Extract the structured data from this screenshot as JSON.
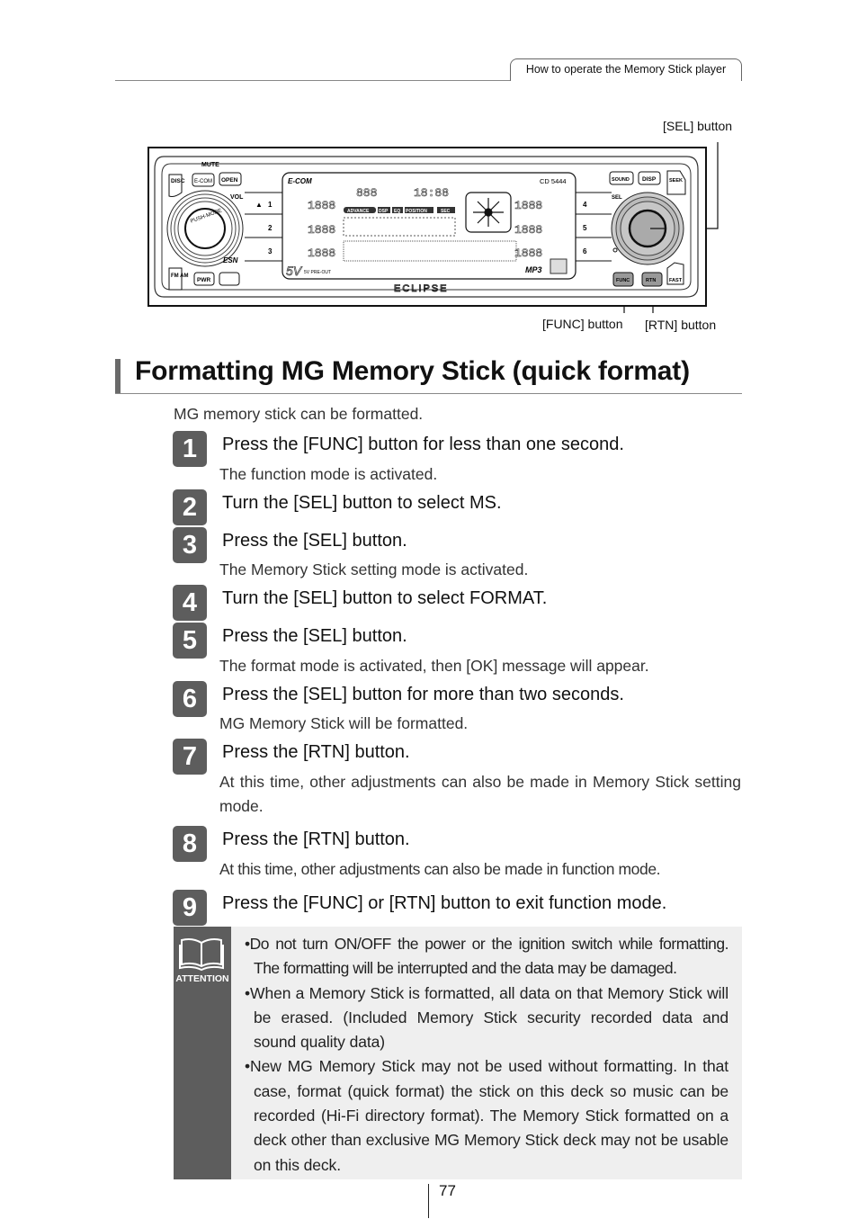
{
  "header": {
    "section_tab": "How to operate the Memory Stick player"
  },
  "figure": {
    "callouts": {
      "sel": "[SEL] button",
      "func": "[FUNC] button",
      "rtn": "[RTN] button"
    },
    "device_labels": {
      "mute": "MUTE",
      "disc": "DISC",
      "ecom": "E-COM",
      "open": "OPEN",
      "vol": "VOL",
      "push_mode": "PUSH-MODE",
      "esn": "ESN",
      "fm_am": "FM AM",
      "pwr": "PWR",
      "presets": [
        "1",
        "2",
        "3",
        "4",
        "5",
        "6"
      ],
      "sound": "SOUND",
      "disp": "DISP",
      "seek": "SEEK",
      "sel": "SEL",
      "func": "FUNC",
      "rtn": "RTN",
      "fast": "FAST",
      "display_brand": "E-COM",
      "model": "CD 5444",
      "brand": "ECLIPSE",
      "pre_out": "5V PRE-OUT",
      "mp3": "MP3",
      "display_tags": [
        "ADVANCE",
        "DSP",
        "EQ",
        "POSITION",
        "SEC"
      ]
    }
  },
  "title": "Formatting MG Memory Stick (quick format)",
  "intro": "MG memory stick can be formatted.",
  "steps": [
    {
      "num": "1",
      "text": "Press the [FUNC] button for less than one second.",
      "sub": "The function mode is activated."
    },
    {
      "num": "2",
      "text": "Turn the [SEL] button to select MS.",
      "sub": ""
    },
    {
      "num": "3",
      "text": "Press the [SEL] button.",
      "sub": "The Memory Stick setting mode is activated."
    },
    {
      "num": "4",
      "text": "Turn the [SEL] button to select FORMAT.",
      "sub": ""
    },
    {
      "num": "5",
      "text": "Press the [SEL] button.",
      "sub": "The format mode is activated, then [OK] message will appear."
    },
    {
      "num": "6",
      "text": "Press the [SEL] button for more than two seconds.",
      "sub": "MG Memory Stick will be formatted."
    },
    {
      "num": "7",
      "text": "Press the [RTN] button.",
      "sub": "At this time, other adjustments can also be made in Memory Stick setting mode."
    },
    {
      "num": "8",
      "text": "Press the [RTN] button.",
      "sub": "At this time, other adjustments can also be made in function mode."
    },
    {
      "num": "9",
      "text": "Press the [FUNC] or [RTN] button to exit function mode.",
      "sub": ""
    }
  ],
  "attention": {
    "label": "ATTENTION",
    "icon": "open-book-icon",
    "items": [
      "•Do not turn ON/OFF the power or the ignition switch while formatting. The formatting will be interrupted and the data may be damaged.",
      "•When a Memory Stick is formatted, all data on that Memory Stick will be erased. (Included Memory Stick security recorded data and sound quality data)",
      "•New MG Memory Stick may not be used without formatting. In that case, format (quick format) the stick on this deck so music can be recorded (Hi-Fi directory format). The Memory Stick formatted on a deck other than exclusive MG Memory Stick deck may not be usable on this deck."
    ]
  },
  "footer": {
    "page_number": "77"
  }
}
